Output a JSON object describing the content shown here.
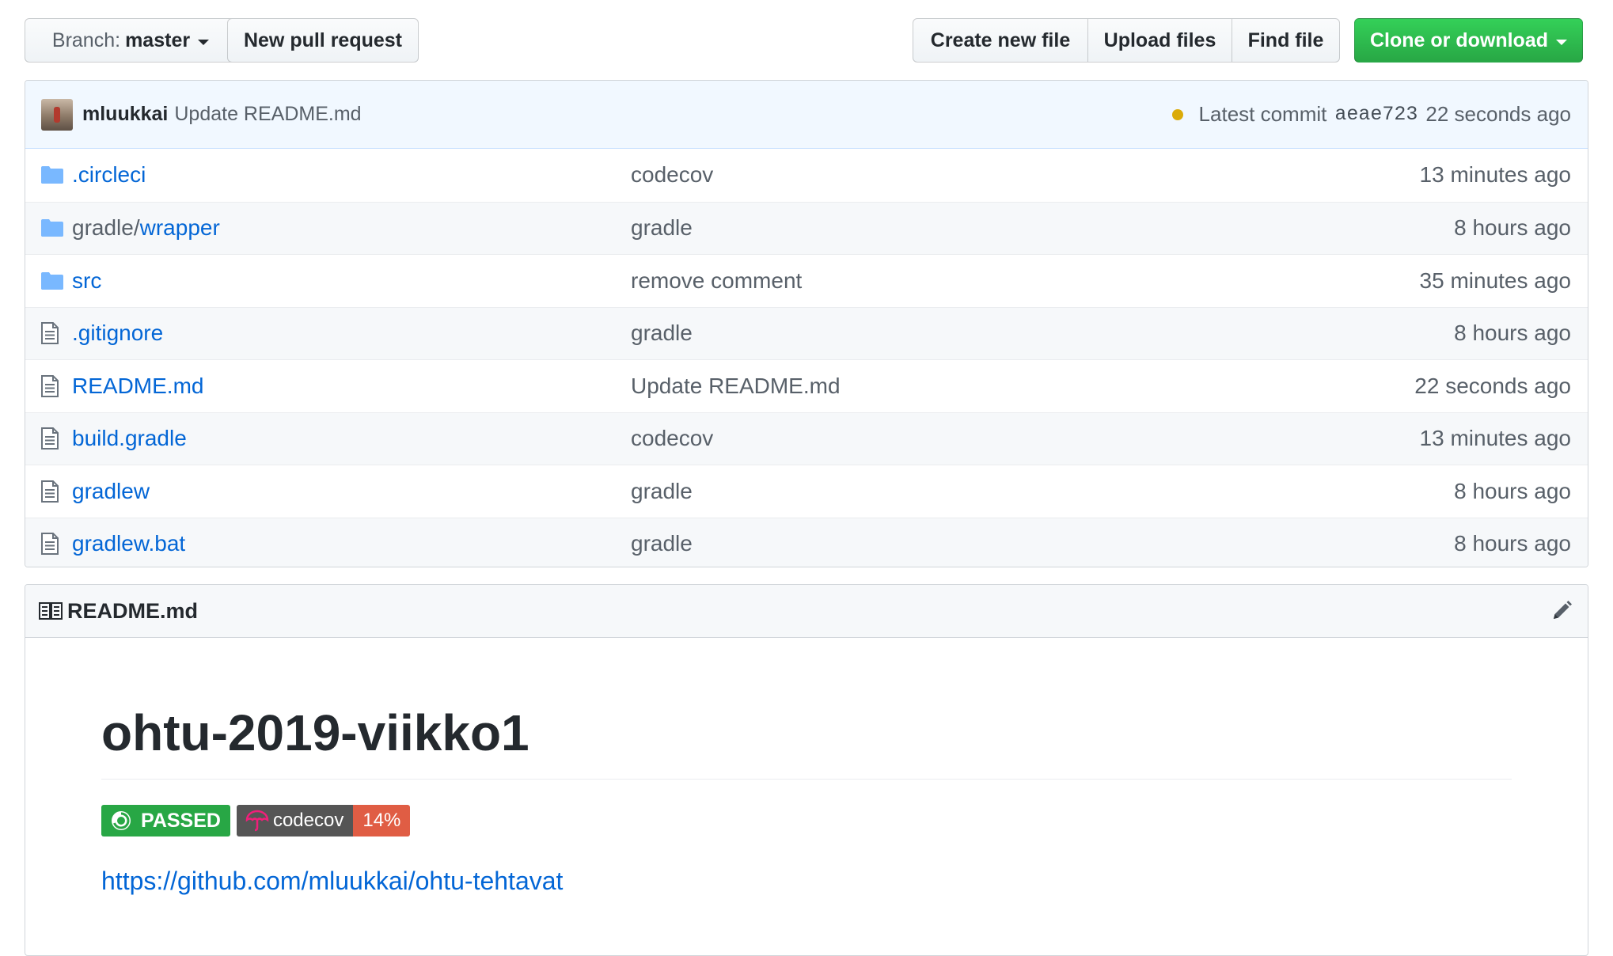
{
  "toolbar": {
    "branch_prefix": "Branch:",
    "branch_name": "master",
    "new_pull_request": "New pull request",
    "create_new_file": "Create new file",
    "upload_files": "Upload files",
    "find_file": "Find file",
    "clone_or_download": "Clone or download"
  },
  "commit": {
    "author": "mluukkai",
    "message": "Update README.md",
    "status_color": "#dbab09",
    "latest_label": "Latest commit",
    "sha": "aeae723",
    "time": "22 seconds ago"
  },
  "files": [
    {
      "type": "folder",
      "dir": "",
      "name": ".circleci",
      "message": "codecov",
      "age": "13 minutes ago"
    },
    {
      "type": "folder",
      "dir": "gradle/",
      "name": "wrapper",
      "message": "gradle",
      "age": "8 hours ago"
    },
    {
      "type": "folder",
      "dir": "",
      "name": "src",
      "message": "remove comment",
      "age": "35 minutes ago"
    },
    {
      "type": "file",
      "dir": "",
      "name": ".gitignore",
      "message": "gradle",
      "age": "8 hours ago"
    },
    {
      "type": "file",
      "dir": "",
      "name": "README.md",
      "message": "Update README.md",
      "age": "22 seconds ago"
    },
    {
      "type": "file",
      "dir": "",
      "name": "build.gradle",
      "message": "codecov",
      "age": "13 minutes ago"
    },
    {
      "type": "file",
      "dir": "",
      "name": "gradlew",
      "message": "gradle",
      "age": "8 hours ago"
    },
    {
      "type": "file",
      "dir": "",
      "name": "gradlew.bat",
      "message": "gradle",
      "age": "8 hours ago"
    }
  ],
  "readme": {
    "file_name": "README.md",
    "heading": "ohtu-2019-viikko1",
    "badge_passed": "PASSED",
    "badge_codecov_label": "codecov",
    "badge_codecov_value": "14%",
    "link": "https://github.com/mluukkai/ohtu-tehtavat"
  },
  "colors": {
    "link": "#0366d6",
    "green_button": "#28a745",
    "coverage_badge": "#e05d44"
  }
}
